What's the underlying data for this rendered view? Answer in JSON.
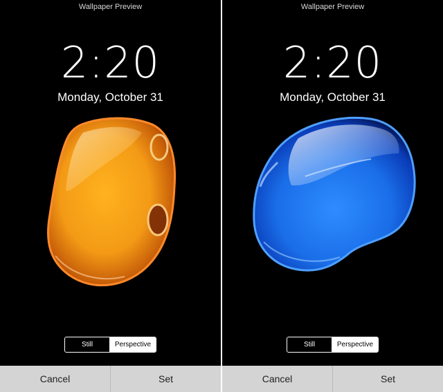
{
  "panels": [
    {
      "title": "Wallpaper Preview",
      "time": "2:20",
      "date": "Monday, October 31",
      "segment": {
        "still": "Still",
        "perspective": "Perspective",
        "selected": "Perspective"
      },
      "buttons": {
        "cancel": "Cancel",
        "set": "Set"
      },
      "wallpaper": {
        "theme": "orange-liquid-drop",
        "color": "#f39a16"
      }
    },
    {
      "title": "Wallpaper Preview",
      "time": "2:20",
      "date": "Monday, October 31",
      "segment": {
        "still": "Still",
        "perspective": "Perspective",
        "selected": "Perspective"
      },
      "buttons": {
        "cancel": "Cancel",
        "set": "Set"
      },
      "wallpaper": {
        "theme": "blue-liquid-drop",
        "color": "#1a6ee8"
      }
    }
  ]
}
